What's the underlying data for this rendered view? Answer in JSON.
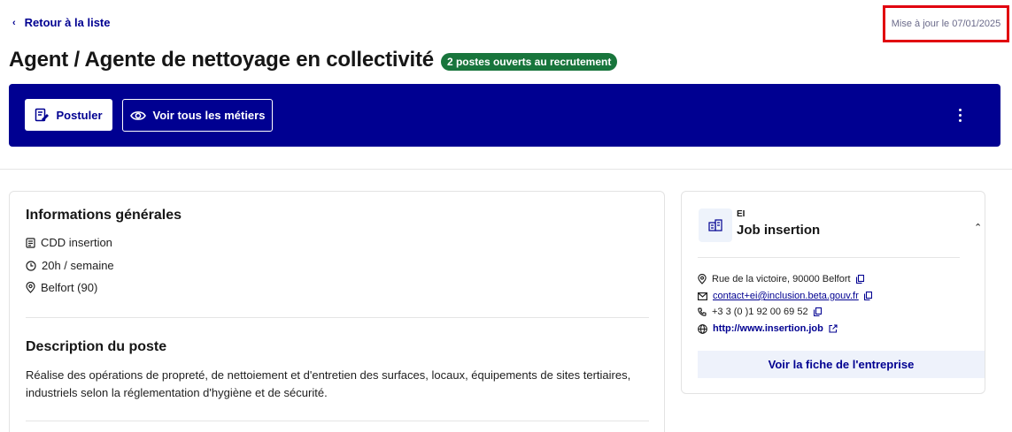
{
  "header": {
    "back_label": "Retour à la liste",
    "updated": "Mise à jour le 07/01/2025",
    "title": "Agent / Agente de nettoyage en collectivité",
    "badge": "2 postes ouverts au recrutement"
  },
  "toolbar": {
    "apply_label": "Postuler",
    "all_jobs_label": "Voir tous les métiers"
  },
  "general": {
    "title": "Informations générales",
    "contract": "CDD insertion",
    "hours": "20h / semaine",
    "location": "Belfort (90)"
  },
  "description": {
    "title": "Description du poste",
    "text": "Réalise des opérations de propreté, de nettoiement et d'entretien des surfaces, locaux, équipements de sites tertiaires, industriels selon la réglementation d'hygiène et de sécurité."
  },
  "company": {
    "type": "EI",
    "name": "Job insertion",
    "address": "Rue de la victoire, 90000 Belfort",
    "email": "contact+ei@inclusion.beta.gouv.fr",
    "phone": "+3 3 (0 )1 92 00 69 52",
    "website": "http://www.insertion.job",
    "button_label": "Voir la fiche de l'entreprise"
  },
  "colors": {
    "primary": "#000091",
    "badge": "#18753c",
    "highlight": "#e1000f"
  }
}
